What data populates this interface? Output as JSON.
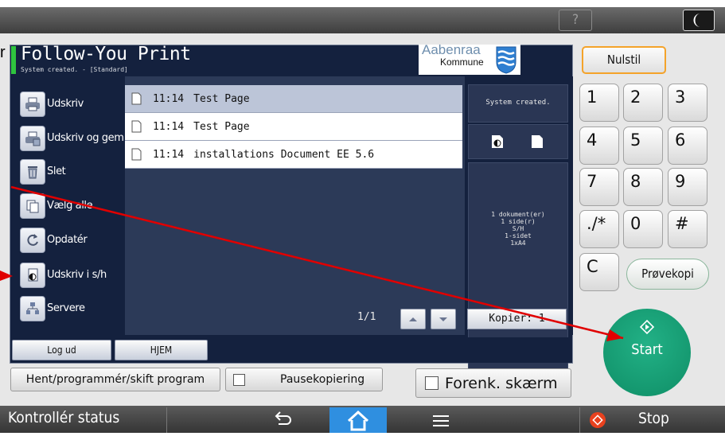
{
  "topbar": {
    "help_label": "?",
    "moon_icon": "moon-icon"
  },
  "app": {
    "title": "Follow-You Print",
    "status": "System created. - [Standard]"
  },
  "brand": {
    "name": "Aabenraa",
    "sub": "Kommune"
  },
  "sidebar": {
    "items": [
      {
        "label": "Udskriv",
        "icon": "printer-icon"
      },
      {
        "label": "Udskriv og gem",
        "icon": "print-save-icon"
      },
      {
        "label": "Slet",
        "icon": "trash-icon"
      },
      {
        "label": "Vælg alle",
        "icon": "select-all-icon"
      },
      {
        "label": "Opdatér",
        "icon": "refresh-icon"
      },
      {
        "label": "Udskriv i s/h",
        "icon": "print-bw-icon"
      },
      {
        "label": "Servere",
        "icon": "servers-icon"
      }
    ]
  },
  "jobs": [
    {
      "time": "11:14",
      "name": "Test Page",
      "selected": true
    },
    {
      "time": "11:14",
      "name": "Test Page",
      "selected": false
    },
    {
      "time": "11:14",
      "name": "installations Document EE 5.6",
      "selected": false
    }
  ],
  "detail": {
    "status": "System created.",
    "info_lines": [
      "1 dokument(er)",
      "1 side(r)",
      "S/H",
      "1-sidet",
      "1xA4"
    ]
  },
  "pager": {
    "label": "1/1"
  },
  "copies": {
    "label": "Kopier: 1"
  },
  "footer": {
    "logout": "Log ud",
    "home": "HJEM"
  },
  "lower": {
    "program_label": "Hent/programmér/skift program",
    "pause_label": "Pausekopiering",
    "simplify_label": "Forenk. skærm"
  },
  "keypad": {
    "reset_label": "Nulstil",
    "keys": [
      "1",
      "2",
      "3",
      "4",
      "5",
      "6",
      "7",
      "8",
      "9",
      "./*",
      "0",
      "#",
      "C"
    ],
    "sample_label": "Prøvekopi",
    "start_label": "Start"
  },
  "bottombar": {
    "status_label": "Kontrollér status",
    "stop_label": "Stop"
  },
  "colors": {
    "screen_bg": "#14213e",
    "start_green": "#14a077",
    "reset_border": "#f4a32a",
    "highlight_blue": "#2f8fe0",
    "status_green": "#2fc43f",
    "annotation_red": "#e00000"
  }
}
